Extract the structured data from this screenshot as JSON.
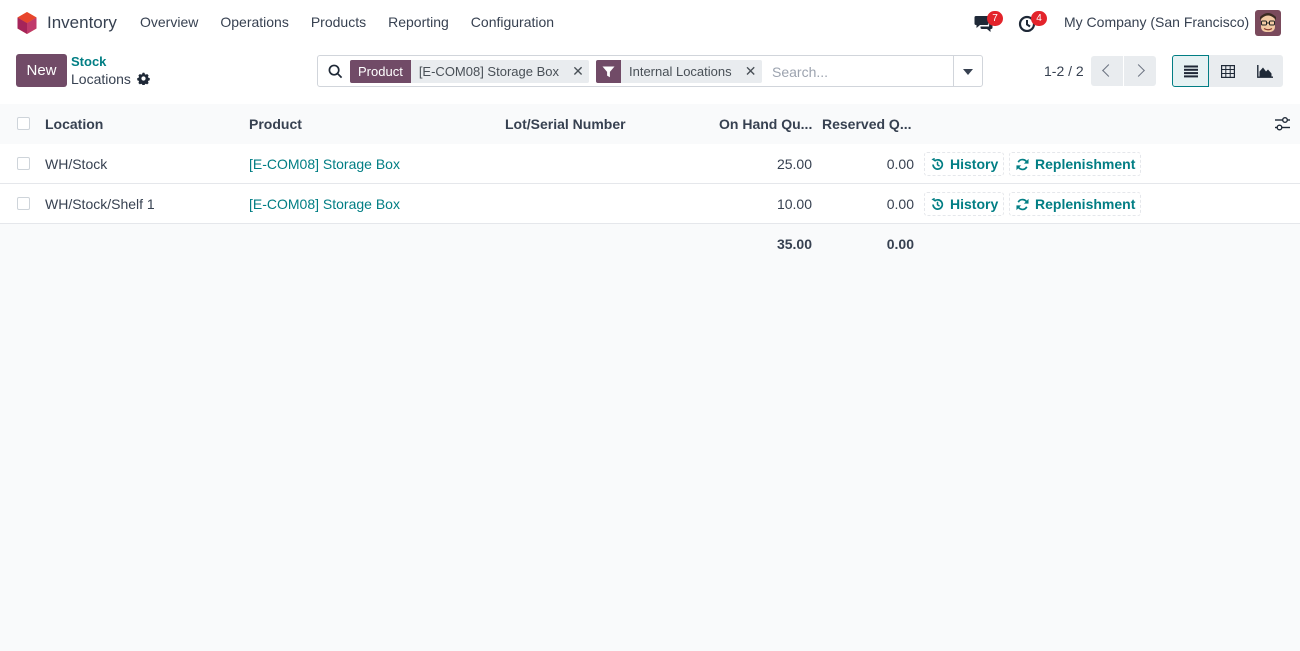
{
  "app": {
    "name": "Inventory",
    "brand_color": "#714b67",
    "accent_color": "#017e84"
  },
  "menu": {
    "items": [
      "Overview",
      "Operations",
      "Products",
      "Reporting",
      "Configuration"
    ]
  },
  "systray": {
    "messages_count": "7",
    "activities_count": "4",
    "company": "My Company (San Francisco)"
  },
  "control_panel": {
    "new_label": "New",
    "breadcrumb_parent": "Stock",
    "breadcrumb_current": "Locations"
  },
  "search": {
    "facets": [
      {
        "label": "Product",
        "value": "[E-COM08] Storage Box",
        "icon": "none"
      },
      {
        "label": "",
        "value": "Internal Locations",
        "icon": "filter-icon"
      }
    ],
    "placeholder": "Search..."
  },
  "pager": {
    "text": "1-2 / 2"
  },
  "views": {
    "items": [
      "list-view",
      "pivot-view",
      "graph-view"
    ],
    "active": "list-view"
  },
  "table": {
    "columns": [
      "Location",
      "Product",
      "Lot/Serial Number",
      "On Hand Qu...",
      "Reserved Q..."
    ],
    "rows": [
      {
        "location": "WH/Stock",
        "product": "[E-COM08] Storage Box",
        "lot": "",
        "on_hand": "25.00",
        "reserved": "0.00",
        "history_label": "History",
        "replenishment_label": "Replenishment"
      },
      {
        "location": "WH/Stock/Shelf 1",
        "product": "[E-COM08] Storage Box",
        "lot": "",
        "on_hand": "10.00",
        "reserved": "0.00",
        "history_label": "History",
        "replenishment_label": "Replenishment"
      }
    ],
    "totals": {
      "on_hand": "35.00",
      "reserved": "0.00"
    }
  }
}
